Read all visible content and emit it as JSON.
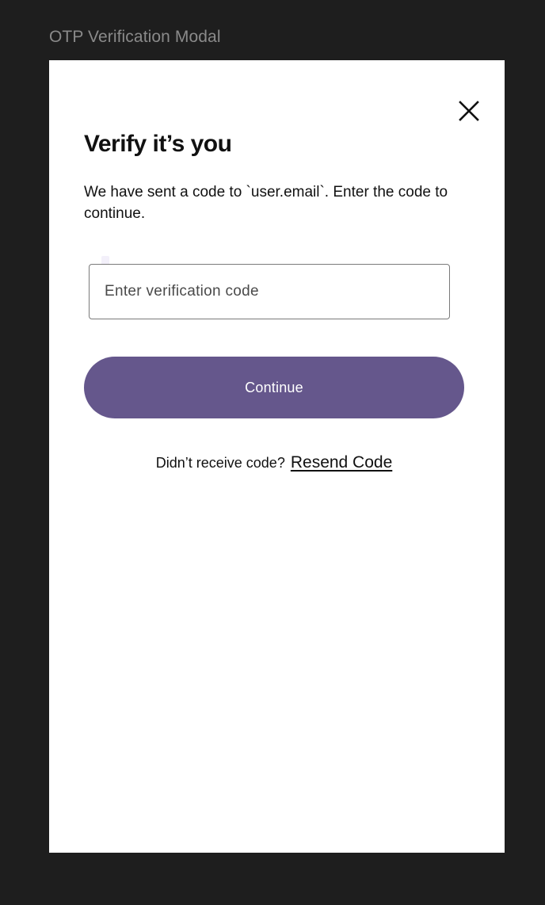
{
  "frame": {
    "label": "OTP Verification Modal"
  },
  "modal": {
    "close_icon": "close-icon",
    "title": "Verify it’s you",
    "subtitle": "We have sent a code to `user.email`. Enter the code to continue.",
    "code_input": {
      "value": "",
      "placeholder": "Enter verification code"
    },
    "continue_label": "Continue",
    "resend_prompt": "Didn’t receive code?",
    "resend_link": "Resend Code"
  },
  "colors": {
    "background": "#1e1e1e",
    "modal_bg": "#ffffff",
    "primary_button": "#65578c",
    "text": "#111111"
  }
}
